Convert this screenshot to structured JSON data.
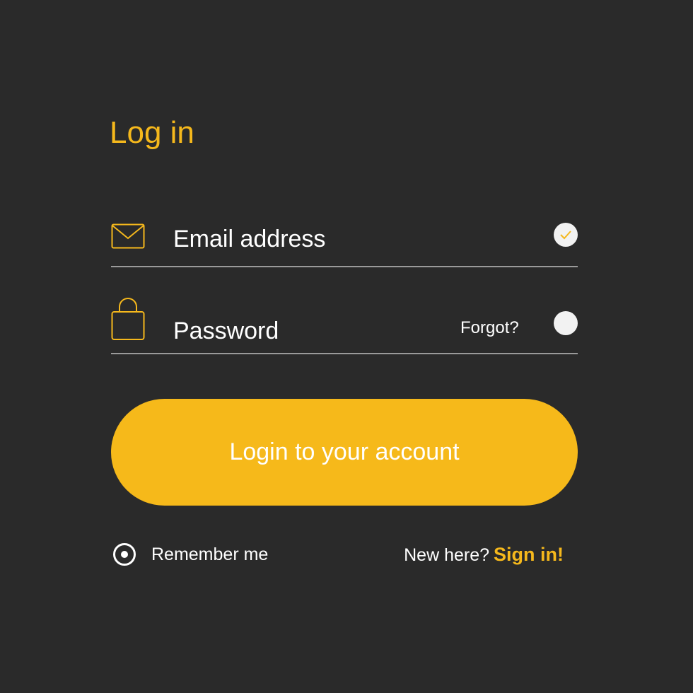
{
  "colors": {
    "background": "#2a2a2a",
    "accent": "#f5b81c",
    "text": "#ffffff",
    "divider": "#9a9a9a",
    "status_dot": "#f2f2f2"
  },
  "title": "Log in",
  "email_field": {
    "placeholder": "Email address",
    "icon": "envelope-icon",
    "status_icon": "checkmark-icon",
    "valid": true
  },
  "password_field": {
    "placeholder": "Password",
    "icon": "padlock-icon",
    "forgot_label": "Forgot?",
    "valid": false
  },
  "login_button": {
    "label": "Login to your account"
  },
  "remember_me": {
    "label": "Remember me",
    "checked": true
  },
  "signup": {
    "prompt": "New here?",
    "link_label": "Sign in!"
  }
}
